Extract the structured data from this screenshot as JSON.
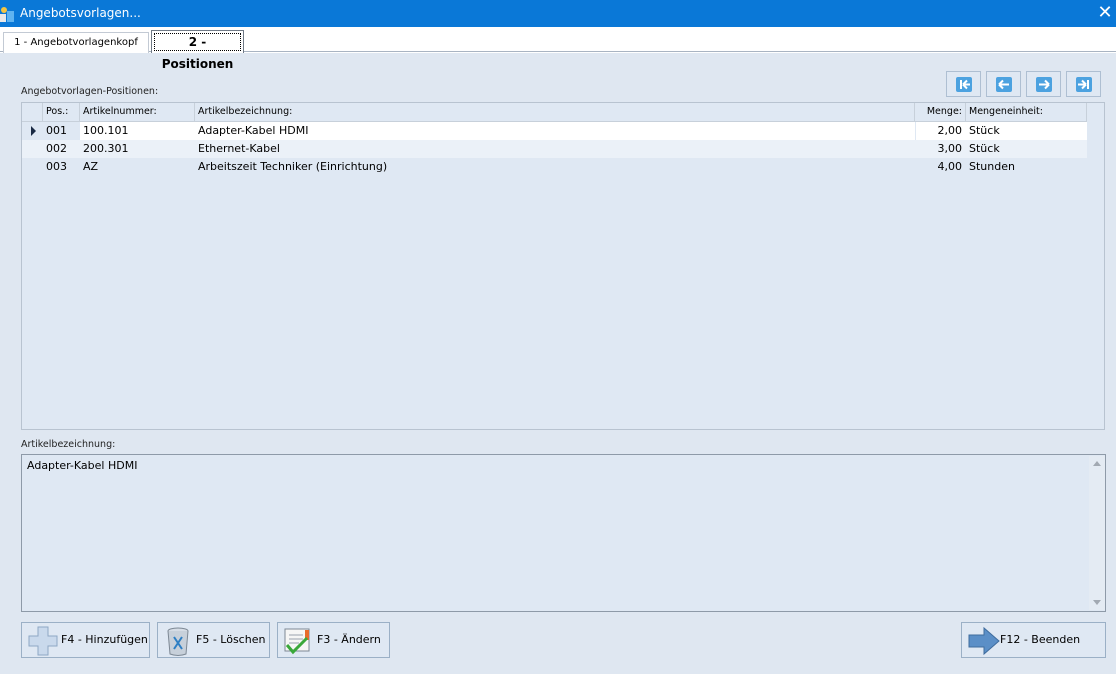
{
  "window": {
    "title": "Angebotsvorlagen..."
  },
  "tabs": [
    {
      "label": "1 - Angebotvorlagenkopf"
    },
    {
      "label": "2 - Positionen"
    }
  ],
  "grid": {
    "label": "Angebotvorlagen-Positionen:",
    "columns": [
      "Pos.:",
      "Artikelnummer:",
      "Artikelbezeichnung:",
      "Menge:",
      "Mengeneinheit:"
    ],
    "rows": [
      {
        "pos": "001",
        "artikelnummer": "100.101",
        "bezeichnung": "Adapter-Kabel HDMI",
        "menge": "2,00",
        "einheit": "Stück"
      },
      {
        "pos": "002",
        "artikelnummer": "200.301",
        "bezeichnung": "Ethernet-Kabel",
        "menge": "3,00",
        "einheit": "Stück"
      },
      {
        "pos": "003",
        "artikelnummer": "AZ",
        "bezeichnung": "Arbeitszeit Techniker (Einrichtung)",
        "menge": "4,00",
        "einheit": "Stunden"
      }
    ]
  },
  "detail": {
    "label": "Artikelbezeichnung:",
    "value": "Adapter-Kabel HDMI"
  },
  "nav_icons": [
    "first-record-icon",
    "previous-record-icon",
    "next-record-icon",
    "last-record-icon"
  ],
  "buttons": {
    "add": "F4 - Hinzufügen",
    "delete": "F5 - Löschen",
    "edit": "F3 - Ändern",
    "exit": "F12 - Beenden"
  },
  "colors": {
    "titlebar": "#0a78d7",
    "background": "#dfe7f1",
    "accent": "#4ca2e0"
  }
}
